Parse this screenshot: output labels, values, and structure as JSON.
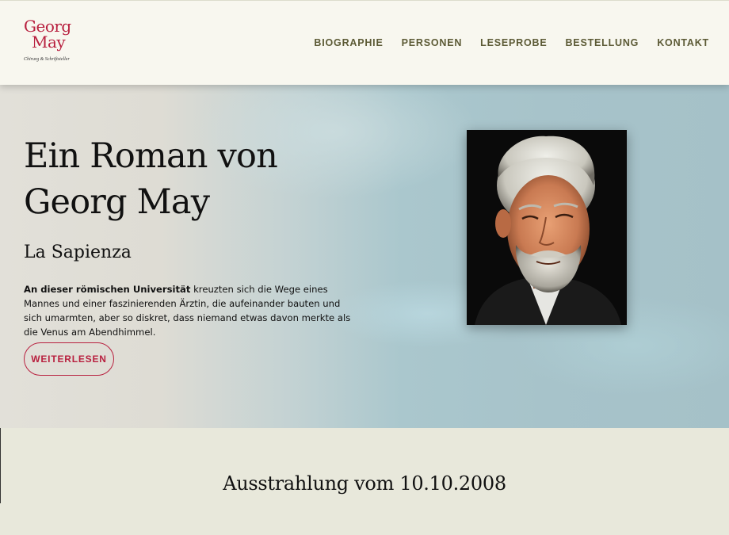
{
  "logo": {
    "line1": "Georg",
    "line2": "May",
    "tagline": "Chirurg & Schriftsteller"
  },
  "nav": {
    "items": [
      "BIOGRAPHIE",
      "PERSONEN",
      "LESEPROBE",
      "BESTELLUNG",
      "KONTAKT"
    ]
  },
  "hero": {
    "title": "Ein Roman von Georg May",
    "subtitle": "La Sapienza",
    "desc_bold": "An dieser römischen Universität",
    "desc_rest": " kreuzten sich die Wege eines Mannes und einer faszinierenden Ärztin, die aufeinander bauten und sich umarmten, aber so diskret, dass niemand etwas davon merkte als die Venus am Abendhimmel.",
    "button_label": "WEITERLESEN"
  },
  "section": {
    "title": "Ausstrahlung vom 10.10.2008"
  },
  "colors": {
    "accent": "#b8203f",
    "nav_text": "#5c5a35",
    "header_bg": "#f8f7ef",
    "section_bg": "#e8e8db"
  }
}
